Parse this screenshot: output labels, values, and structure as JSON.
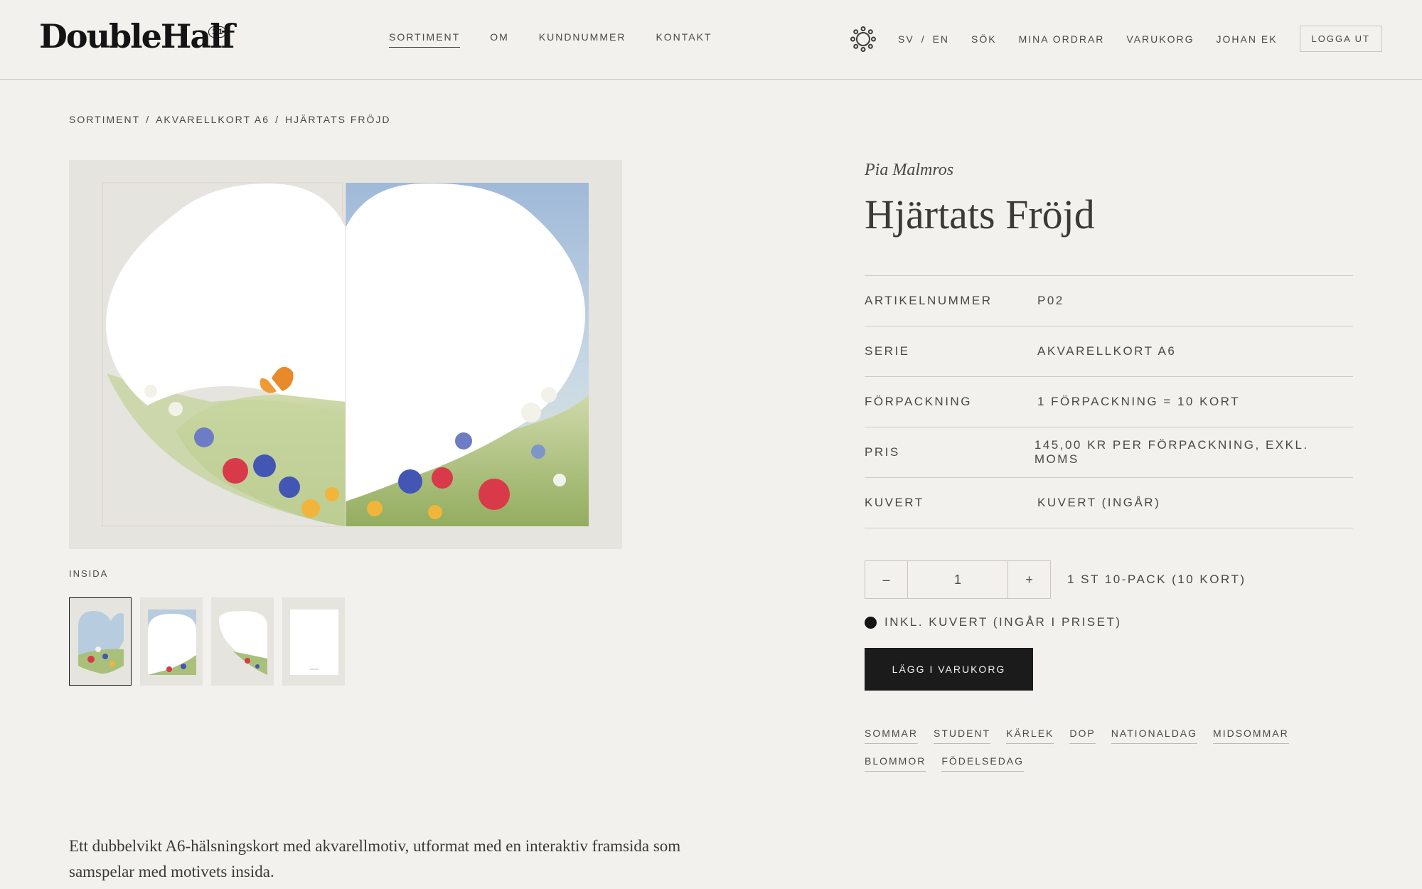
{
  "header": {
    "logo": "DoubleHalf",
    "logo_badge": "1/1",
    "nav": [
      "SORTIMENT",
      "OM",
      "KUNDNUMMER",
      "KONTAKT"
    ],
    "lang_sv": "SV",
    "lang_sep": "/",
    "lang_en": "EN",
    "search": "SÖK",
    "orders": "MINA ORDRAR",
    "cart": "VARUKORG",
    "user": "JOHAN EK",
    "logout": "LOGGA UT"
  },
  "breadcrumb": [
    "SORTIMENT",
    "/",
    "AKVARELLKORT A6",
    "/",
    "HJÄRTATS FRÖJD"
  ],
  "gallery": {
    "caption": "INSIDA",
    "thumb_count": 4
  },
  "product": {
    "artist": "Pia Malmros",
    "title": "Hjärtats Fröjd",
    "specs": [
      {
        "label": "ARTIKELNUMMER",
        "value": "P02"
      },
      {
        "label": "SERIE",
        "value": "AKVARELLKORT A6"
      },
      {
        "label": "FÖRPACKNING",
        "value": "1 FÖRPACKNING = 10 KORT"
      },
      {
        "label": "PRIS",
        "value": "145,00 KR PER FÖRPACKNING, EXKL. MOMS"
      },
      {
        "label": "KUVERT",
        "value": "KUVERT (INGÅR)"
      }
    ],
    "qty_minus": "–",
    "qty_value": "1",
    "qty_plus": "+",
    "qty_note": "1 ST 10-PACK (10 KORT)",
    "envelope_note": "INKL. KUVERT (INGÅR I PRISET)",
    "add_to_cart": "LÄGG I VARUKORG",
    "tags": [
      "SOMMAR",
      "STUDENT",
      "KÄRLEK",
      "DOP",
      "NATIONALDAG",
      "MIDSOMMAR",
      "BLOMMOR",
      "FÖDELSEDAG"
    ],
    "description": "Ett dubbelvikt A6-hälsningskort med akvarellmotiv, utformat med en interaktiv framsida som samspelar med motivets insida."
  },
  "colors": {
    "background": "#f2f1ed",
    "button_dark": "#1b1b1b",
    "text": "#3b3a36"
  }
}
